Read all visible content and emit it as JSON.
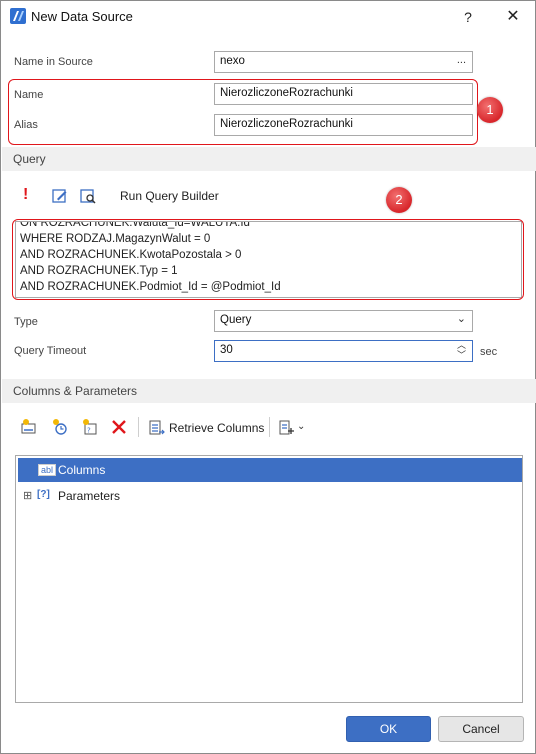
{
  "window": {
    "title": "New Data Source",
    "help_glyph": "?",
    "close_glyph": "✕"
  },
  "source": {
    "name_in_source_label": "Name in Source",
    "name_in_source_value": "nexo",
    "ellipsis": "..."
  },
  "name": {
    "label": "Name",
    "value": "NierozliczoneRozrachunki"
  },
  "alias": {
    "label": "Alias",
    "value": "NierozliczoneRozrachunki"
  },
  "annotations": {
    "badge1": "1",
    "badge2": "2",
    "color": "#e0161b"
  },
  "query": {
    "section_title": "Query",
    "toolbar": {
      "run_query_builder": "Run Query Builder",
      "exclaim": "!"
    },
    "lines": [
      "ON ROZRACHUNEK.Waluta_Id=WALUTA.Id",
      "WHERE RODZAJ.MagazynWalut = 0",
      "AND ROZRACHUNEK.KwotaPozostala > 0",
      "AND ROZRACHUNEK.Typ = 1",
      "AND ROZRACHUNEK.Podmiot_Id = @Podmiot_Id"
    ],
    "type_label": "Type",
    "type_value": "Query",
    "timeout_label": "Query Timeout",
    "timeout_value": "30",
    "timeout_unit": "sec"
  },
  "columns": {
    "section_title": "Columns & Parameters",
    "toolbar": {
      "retrieve_columns": "Retrieve Columns"
    },
    "tree": [
      {
        "label": "Columns",
        "icon": "abl",
        "selected": true
      },
      {
        "label": "Parameters",
        "icon": "[?]",
        "expander": "⊞"
      }
    ]
  },
  "buttons": {
    "ok": "OK",
    "cancel": "Cancel"
  },
  "colors": {
    "accent": "#3d6fc4",
    "section_bg": "#f0f0f0"
  }
}
